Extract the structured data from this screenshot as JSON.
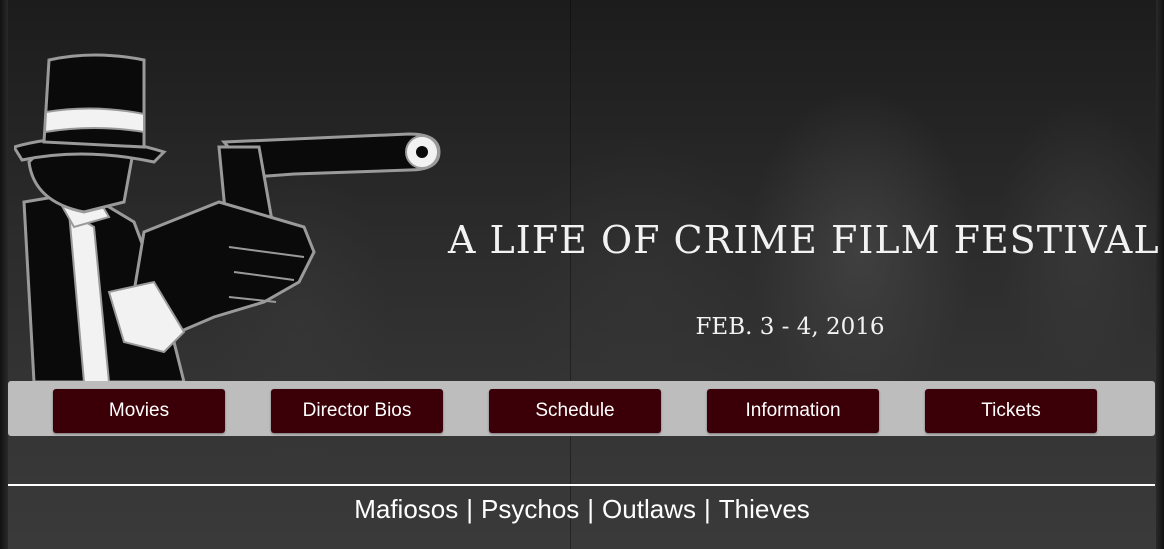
{
  "header": {
    "title": "A LIFE OF CRIME FILM FESTIVAL",
    "date": "FEB. 3 - 4, 2016",
    "logo_icon": "gangster-with-gun-icon"
  },
  "nav": {
    "items": [
      {
        "label": "Movies"
      },
      {
        "label": "Director Bios"
      },
      {
        "label": "Schedule"
      },
      {
        "label": "Information"
      },
      {
        "label": "Tickets"
      }
    ]
  },
  "categories": {
    "items": [
      "Mafiosos",
      "Psychos",
      "Outlaws",
      "Thieves"
    ],
    "separator": "|"
  },
  "colors": {
    "nav_button_bg": "#3b0007",
    "nav_bar_bg": "#bdbdbd",
    "text": "#ffffff"
  }
}
